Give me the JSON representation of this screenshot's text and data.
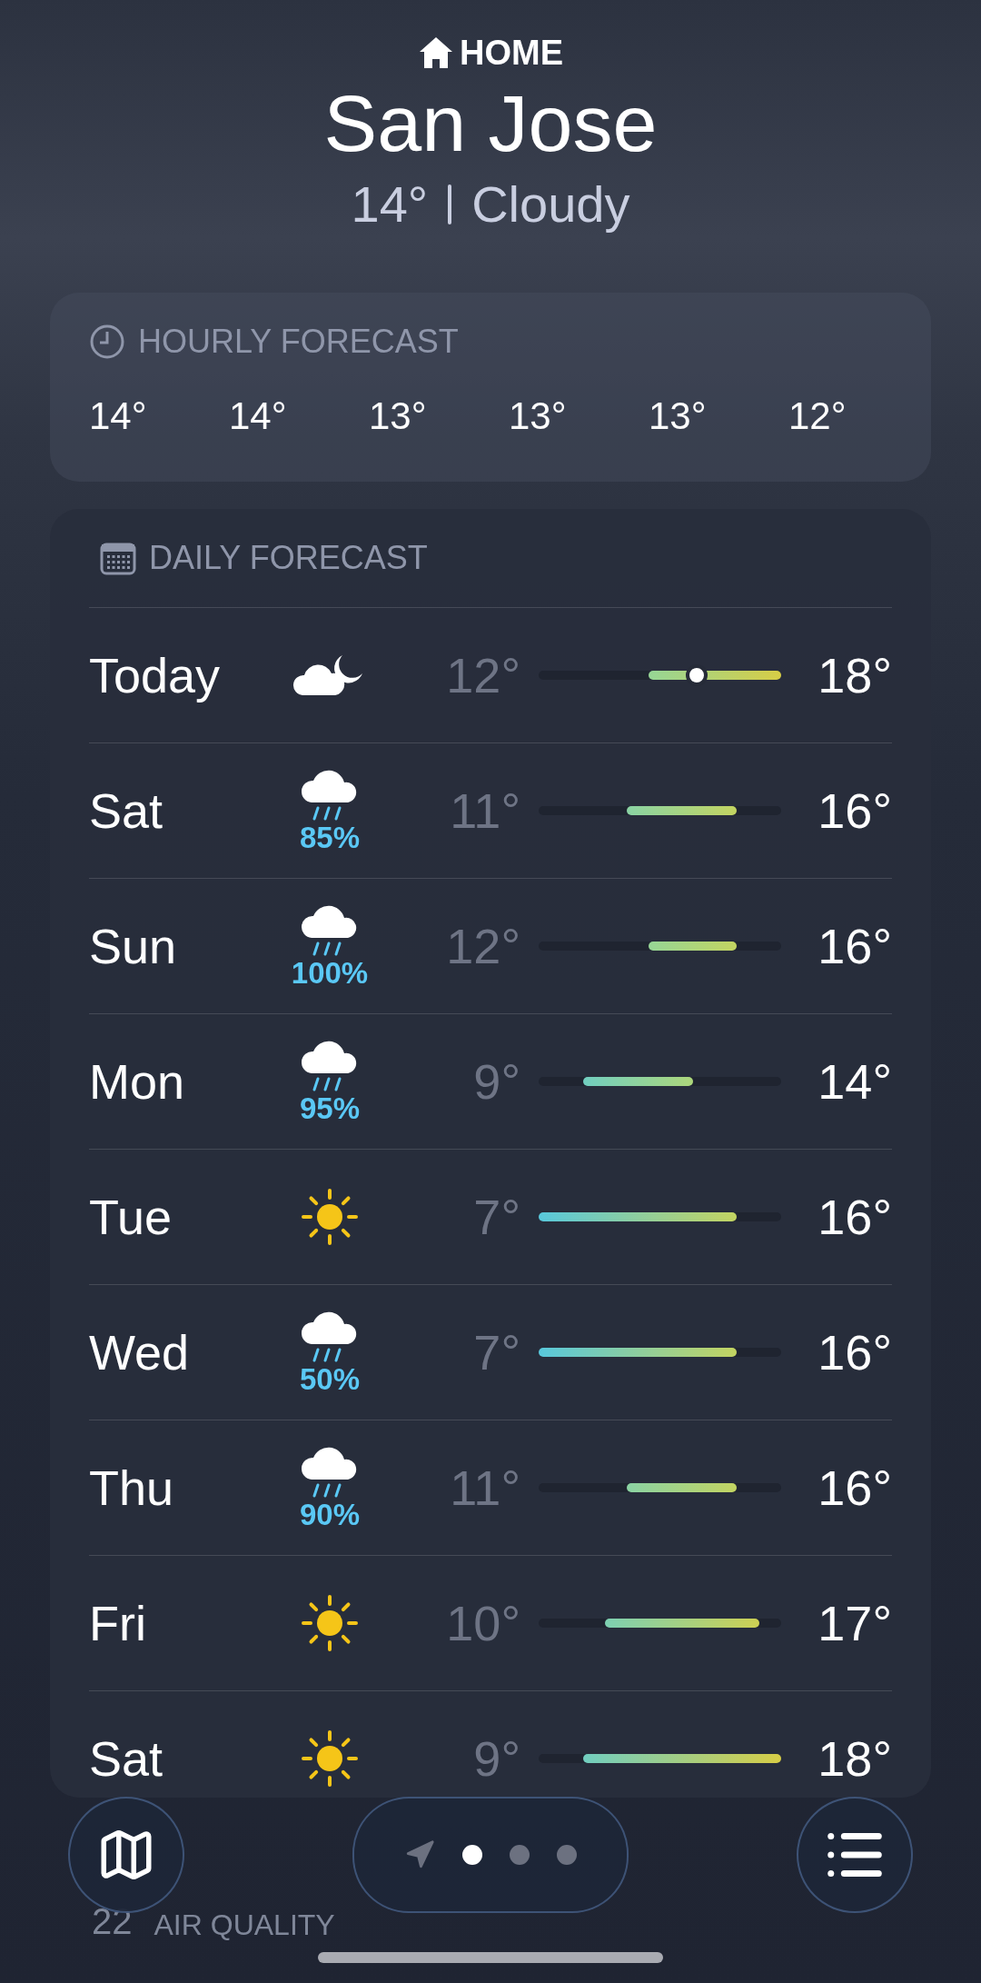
{
  "header": {
    "place_label": "HOME",
    "city": "San Jose",
    "current_temp": "14°",
    "condition": "Cloudy"
  },
  "hourly": {
    "title": "HOURLY FORECAST",
    "temps": [
      "14°",
      "14°",
      "13°",
      "13°",
      "13°",
      "12°"
    ]
  },
  "daily": {
    "title": "DAILY FORECAST",
    "rows": [
      {
        "day": "Today",
        "kind": "moon-cloud",
        "low": "12°",
        "high": "18°",
        "current": true
      },
      {
        "day": "Sat",
        "kind": "rain",
        "precip": "85%",
        "low": "11°",
        "high": "16°",
        "current": false
      },
      {
        "day": "Sun",
        "kind": "rain",
        "precip": "100%",
        "low": "12°",
        "high": "16°",
        "current": false
      },
      {
        "day": "Mon",
        "kind": "rain",
        "precip": "95%",
        "low": "9°",
        "high": "14°",
        "current": false
      },
      {
        "day": "Tue",
        "kind": "sun",
        "low": "7°",
        "high": "16°",
        "current": false
      },
      {
        "day": "Wed",
        "kind": "rain",
        "precip": "50%",
        "low": "7°",
        "high": "16°",
        "current": false
      },
      {
        "day": "Thu",
        "kind": "rain",
        "precip": "90%",
        "low": "11°",
        "high": "16°",
        "current": false
      },
      {
        "day": "Fri",
        "kind": "sun",
        "low": "10°",
        "high": "17°",
        "current": false
      },
      {
        "day": "Sat",
        "kind": "sun",
        "low": "9°",
        "high": "18°",
        "current": false
      }
    ]
  },
  "air_quality": {
    "title": "AIR QUALITY",
    "value": "22"
  },
  "pager": {
    "dots": [
      {
        "selected": true
      },
      {
        "selected": false
      },
      {
        "selected": false
      }
    ]
  }
}
